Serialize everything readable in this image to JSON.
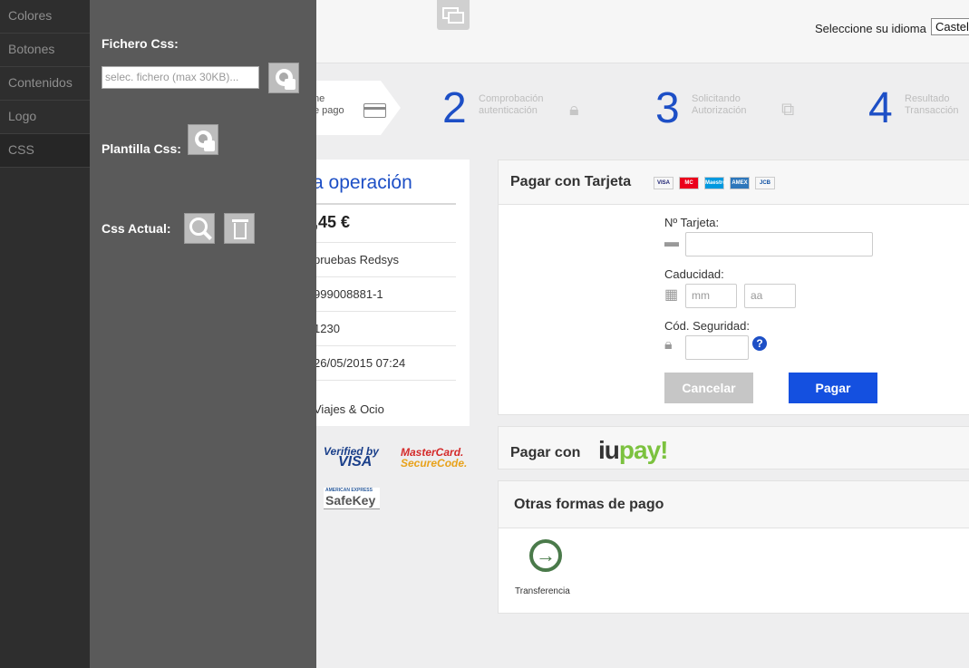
{
  "editor": {
    "nav": [
      "Colores",
      "Botones",
      "Contenidos",
      "Logo",
      "CSS"
    ],
    "file_label": "Fichero Css:",
    "file_placeholder": "selec. fichero (max 30KB)...",
    "template_label": "Plantilla Css:",
    "current_label": "Css Actual:"
  },
  "header": {
    "language_label": "Seleccione su idioma",
    "language_value": "Castel"
  },
  "steps": [
    {
      "num": "",
      "text1": "ne",
      "text2": "e pago"
    },
    {
      "num": "2",
      "text1": "Comprobación",
      "text2": "autenticación"
    },
    {
      "num": "3",
      "text1": "Solicitando",
      "text2": "Autorización"
    },
    {
      "num": "4",
      "text1": "Resultado",
      "text2": "Transacción"
    }
  ],
  "operation": {
    "title": "a operación",
    "amount": ",45  €",
    "merchant": "pruebas Redsys",
    "code": "999008881-1",
    "terminal": "1230",
    "date": "26/05/2015   07:24",
    "description": "Viajes & Ocio"
  },
  "badges": {
    "vbv_top": "Verified by",
    "vbv_bottom": "VISA",
    "mc_top": "MasterCard.",
    "mc_bottom": "SecureCode.",
    "amex_small": "AMERICAN EXPRESS",
    "amex_safekey": "SafeKey"
  },
  "card_payment": {
    "title": "Pagar con Tarjeta",
    "brands": [
      "VISA",
      "MC",
      "Maestro",
      "AMEX",
      "JCB"
    ],
    "card_number_label": "Nº Tarjeta:",
    "expiry_label": "Caducidad:",
    "month_placeholder": "mm",
    "year_placeholder": "aa",
    "cvv_label": "Cód. Seguridad:",
    "help": "?",
    "cancel": "Cancelar",
    "pay": "Pagar"
  },
  "iupay": {
    "title": "Pagar con",
    "logo_a": "iu",
    "logo_b": "pay!"
  },
  "other": {
    "title": "Otras formas de pago",
    "transfer_icon": "→",
    "transfer_label": "Transferencia"
  },
  "colors": {
    "accent_blue": "#1d4fc6",
    "pay_button": "#1450e0",
    "editor_panel": "#5a5a5a",
    "editor_nav": "#2e2e2e"
  }
}
